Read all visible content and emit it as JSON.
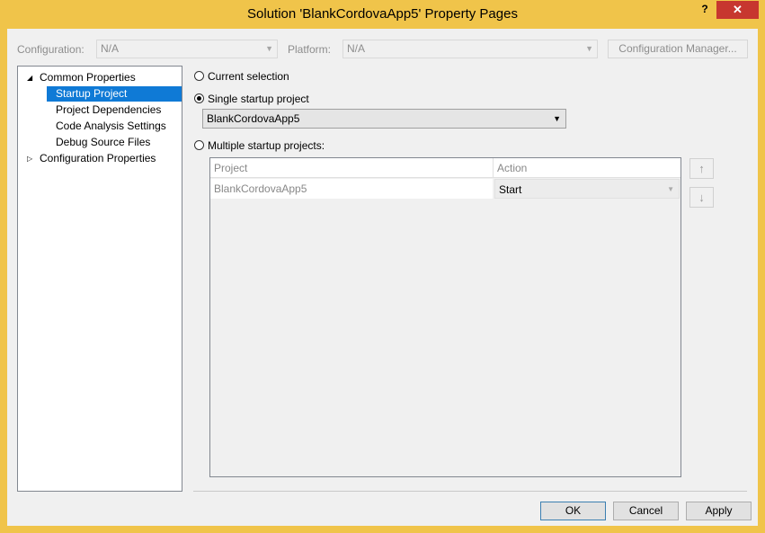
{
  "window": {
    "title": "Solution 'BlankCordovaApp5' Property Pages",
    "help_glyph": "?",
    "close_glyph": "✕"
  },
  "config_bar": {
    "configuration_label": "Configuration:",
    "configuration_value": "N/A",
    "platform_label": "Platform:",
    "platform_value": "N/A",
    "config_manager_label": "Configuration Manager..."
  },
  "tree": {
    "items": [
      {
        "label": "Common Properties"
      },
      {
        "label": "Startup Project"
      },
      {
        "label": "Project Dependencies"
      },
      {
        "label": "Code Analysis Settings"
      },
      {
        "label": "Debug Source Files"
      },
      {
        "label": "Configuration Properties"
      }
    ]
  },
  "startup": {
    "current_selection_label": "Current selection",
    "single_label": "Single startup project",
    "single_value": "BlankCordovaApp5",
    "multiple_label": "Multiple startup projects:",
    "grid": {
      "headers": [
        "Project",
        "Action"
      ],
      "rows": [
        {
          "project": "BlankCordovaApp5",
          "action": "Start"
        }
      ]
    },
    "move_up_glyph": "↑",
    "move_down_glyph": "↓"
  },
  "footer": {
    "ok_label": "OK",
    "cancel_label": "Cancel",
    "apply_label": "Apply"
  },
  "colors": {
    "titlebar": "#f0c44a",
    "selection": "#0f7ad6",
    "close": "#c7372f"
  }
}
